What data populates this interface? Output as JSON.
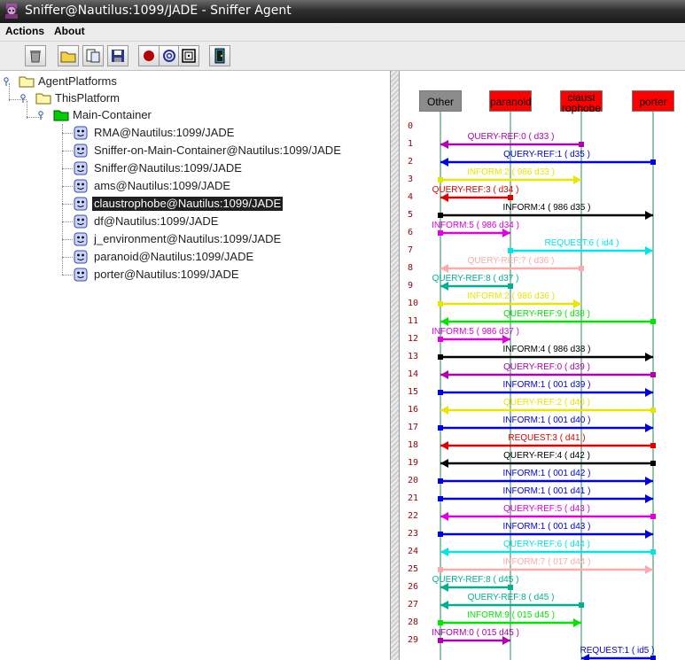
{
  "window": {
    "title": "Sniffer@Nautilus:1099/JADE - Sniffer Agent"
  },
  "menu": {
    "items": [
      "Actions",
      "About"
    ]
  },
  "toolbar": {
    "buttons": [
      "clear-canvas-icon",
      "open-folder-icon",
      "open-snapshot-icon",
      "save-icon",
      "record-icon",
      "spiral-icon",
      "target-icon",
      "exit-door-icon"
    ]
  },
  "tree": {
    "root": "AgentPlatforms",
    "platform": "ThisPlatform",
    "container": "Main-Container",
    "agents": [
      "RMA@Nautilus:1099/JADE",
      "Sniffer-on-Main-Container@Nautilus:1099/JADE",
      "Sniffer@Nautilus:1099/JADE",
      "ams@Nautilus:1099/JADE",
      "claustrophobe@Nautilus:1099/JADE",
      "df@Nautilus:1099/JADE",
      "j_environment@Nautilus:1099/JADE",
      "paranoid@Nautilus:1099/JADE",
      "porter@Nautilus:1099/JADE"
    ],
    "selected_index": 4
  },
  "sniffer": {
    "agents": [
      {
        "name": "Other",
        "color": "#8c8c8c"
      },
      {
        "name": "paranoid",
        "color": "#ff0000"
      },
      {
        "name": "claust\nrophobe",
        "color": "#ff0000"
      },
      {
        "name": "porter",
        "color": "#ff0000"
      }
    ],
    "row_numbers": [
      "0",
      "1",
      "2",
      "3",
      "4",
      "5",
      "6",
      "7",
      "8",
      "9",
      "10",
      "11",
      "12",
      "13",
      "14",
      "15",
      "16",
      "17",
      "18",
      "19",
      "20",
      "21",
      "22",
      "23",
      "24",
      "25",
      "26",
      "27",
      "28",
      "29"
    ],
    "messages": [
      {
        "row": 1,
        "from": 2,
        "to": 0,
        "label": "QUERY-REF:0 (  d33  )",
        "color": "#b000b0"
      },
      {
        "row": 2,
        "from": 3,
        "to": 0,
        "label": "QUERY-REF:1 (  d35   )",
        "color": "#0000e0"
      },
      {
        "row": 3,
        "from": 0,
        "to": 2,
        "label": "INFORM:2 (  986  d33 )",
        "color": "#e6e600"
      },
      {
        "row": 4,
        "from": 1,
        "to": 0,
        "label": "QUERY-REF:3 (  d34   )",
        "color": "#e00000"
      },
      {
        "row": 5,
        "from": 0,
        "to": 3,
        "label": "INFORM:4 (  986  d35 )",
        "color": "#000000"
      },
      {
        "row": 6,
        "from": 0,
        "to": 1,
        "label": "INFORM:5 (  986  d34 )",
        "color": "#e000e0"
      },
      {
        "row": 7,
        "from": 1,
        "to": 3,
        "label": "REQUEST:6 (  id4   )",
        "color": "#00e6e6"
      },
      {
        "row": 8,
        "from": 2,
        "to": 0,
        "label": "QUERY-REF:7 (  d36   )",
        "color": "#ffaaaa"
      },
      {
        "row": 9,
        "from": 1,
        "to": 0,
        "label": "QUERY-REF:8 (  d37   )",
        "color": "#00b090"
      },
      {
        "row": 10,
        "from": 0,
        "to": 2,
        "label": "INFORM:2 (  986  d36 )",
        "color": "#e6e600"
      },
      {
        "row": 11,
        "from": 3,
        "to": 0,
        "label": "QUERY-REF:9 (  d38   )",
        "color": "#00e600"
      },
      {
        "row": 12,
        "from": 0,
        "to": 1,
        "label": "INFORM:5 (  986  d37 )",
        "color": "#e000e0"
      },
      {
        "row": 13,
        "from": 0,
        "to": 3,
        "label": "INFORM:4 (  986  d38 )",
        "color": "#000000"
      },
      {
        "row": 14,
        "from": 3,
        "to": 0,
        "label": "QUERY-REF:0 (  d39   )",
        "color": "#b000b0"
      },
      {
        "row": 15,
        "from": 0,
        "to": 3,
        "label": "INFORM:1 (  001  d39 )",
        "color": "#0000e0"
      },
      {
        "row": 16,
        "from": 3,
        "to": 0,
        "label": "QUERY-REF:2 (  d40   )",
        "color": "#e6e600"
      },
      {
        "row": 17,
        "from": 0,
        "to": 3,
        "label": "INFORM:1 (  001  d40 )",
        "color": "#0000e0"
      },
      {
        "row": 18,
        "from": 3,
        "to": 0,
        "label": "REQUEST:3 (  d41   )",
        "color": "#e00000"
      },
      {
        "row": 19,
        "from": 3,
        "to": 0,
        "label": "QUERY-REF:4 (  d42   )",
        "color": "#000000"
      },
      {
        "row": 20,
        "from": 0,
        "to": 3,
        "label": "INFORM:1 (  001  d42 )",
        "color": "#0000e0"
      },
      {
        "row": 21,
        "from": 0,
        "to": 3,
        "label": "INFORM:1 (  001  d41 )",
        "color": "#0000e0"
      },
      {
        "row": 22,
        "from": 3,
        "to": 0,
        "label": "QUERY-REF:5 (  d43   )",
        "color": "#e000e0"
      },
      {
        "row": 23,
        "from": 0,
        "to": 3,
        "label": "INFORM:1 (  001  d43 )",
        "color": "#0000e0"
      },
      {
        "row": 24,
        "from": 3,
        "to": 0,
        "label": "QUERY-REF:6 (  d44   )",
        "color": "#00e6e6"
      },
      {
        "row": 25,
        "from": 0,
        "to": 3,
        "label": "INFORM:7 (  017  d44 )",
        "color": "#ffaaaa"
      },
      {
        "row": 26,
        "from": 1,
        "to": 0,
        "label": "QUERY-REF:8 (  d45   )",
        "color": "#00b090"
      },
      {
        "row": 27,
        "from": 2,
        "to": 0,
        "label": "QUERY-REF:8 (  d45   )",
        "color": "#00b090"
      },
      {
        "row": 28,
        "from": 0,
        "to": 2,
        "label": "INFORM:9 (  015  d45 )",
        "color": "#00e600"
      },
      {
        "row": 29,
        "from": 0,
        "to": 1,
        "label": "INFORM:0 (  015  d45 )",
        "color": "#b000b0"
      },
      {
        "row": 30,
        "from": 3,
        "to": 2,
        "label": "REQUEST:1 (  id5   )",
        "color": "#0000e0"
      }
    ]
  }
}
